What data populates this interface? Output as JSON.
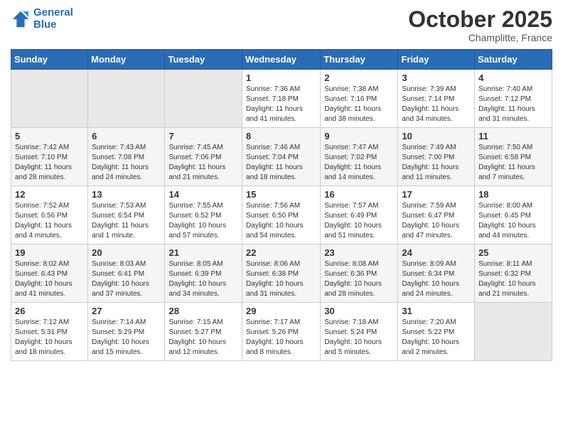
{
  "header": {
    "logo_line1": "General",
    "logo_line2": "Blue",
    "month": "October 2025",
    "location": "Champlitte, France"
  },
  "weekdays": [
    "Sunday",
    "Monday",
    "Tuesday",
    "Wednesday",
    "Thursday",
    "Friday",
    "Saturday"
  ],
  "weeks": [
    [
      {
        "day": "",
        "sunrise": "",
        "sunset": "",
        "daylight": ""
      },
      {
        "day": "",
        "sunrise": "",
        "sunset": "",
        "daylight": ""
      },
      {
        "day": "",
        "sunrise": "",
        "sunset": "",
        "daylight": ""
      },
      {
        "day": "1",
        "sunrise": "Sunrise: 7:36 AM",
        "sunset": "Sunset: 7:18 PM",
        "daylight": "Daylight: 11 hours and 41 minutes."
      },
      {
        "day": "2",
        "sunrise": "Sunrise: 7:38 AM",
        "sunset": "Sunset: 7:16 PM",
        "daylight": "Daylight: 11 hours and 38 minutes."
      },
      {
        "day": "3",
        "sunrise": "Sunrise: 7:39 AM",
        "sunset": "Sunset: 7:14 PM",
        "daylight": "Daylight: 11 hours and 34 minutes."
      },
      {
        "day": "4",
        "sunrise": "Sunrise: 7:40 AM",
        "sunset": "Sunset: 7:12 PM",
        "daylight": "Daylight: 11 hours and 31 minutes."
      }
    ],
    [
      {
        "day": "5",
        "sunrise": "Sunrise: 7:42 AM",
        "sunset": "Sunset: 7:10 PM",
        "daylight": "Daylight: 11 hours and 28 minutes."
      },
      {
        "day": "6",
        "sunrise": "Sunrise: 7:43 AM",
        "sunset": "Sunset: 7:08 PM",
        "daylight": "Daylight: 11 hours and 24 minutes."
      },
      {
        "day": "7",
        "sunrise": "Sunrise: 7:45 AM",
        "sunset": "Sunset: 7:06 PM",
        "daylight": "Daylight: 11 hours and 21 minutes."
      },
      {
        "day": "8",
        "sunrise": "Sunrise: 7:46 AM",
        "sunset": "Sunset: 7:04 PM",
        "daylight": "Daylight: 11 hours and 18 minutes."
      },
      {
        "day": "9",
        "sunrise": "Sunrise: 7:47 AM",
        "sunset": "Sunset: 7:02 PM",
        "daylight": "Daylight: 11 hours and 14 minutes."
      },
      {
        "day": "10",
        "sunrise": "Sunrise: 7:49 AM",
        "sunset": "Sunset: 7:00 PM",
        "daylight": "Daylight: 11 hours and 11 minutes."
      },
      {
        "day": "11",
        "sunrise": "Sunrise: 7:50 AM",
        "sunset": "Sunset: 6:58 PM",
        "daylight": "Daylight: 11 hours and 7 minutes."
      }
    ],
    [
      {
        "day": "12",
        "sunrise": "Sunrise: 7:52 AM",
        "sunset": "Sunset: 6:56 PM",
        "daylight": "Daylight: 11 hours and 4 minutes."
      },
      {
        "day": "13",
        "sunrise": "Sunrise: 7:53 AM",
        "sunset": "Sunset: 6:54 PM",
        "daylight": "Daylight: 11 hours and 1 minute."
      },
      {
        "day": "14",
        "sunrise": "Sunrise: 7:55 AM",
        "sunset": "Sunset: 6:52 PM",
        "daylight": "Daylight: 10 hours and 57 minutes."
      },
      {
        "day": "15",
        "sunrise": "Sunrise: 7:56 AM",
        "sunset": "Sunset: 6:50 PM",
        "daylight": "Daylight: 10 hours and 54 minutes."
      },
      {
        "day": "16",
        "sunrise": "Sunrise: 7:57 AM",
        "sunset": "Sunset: 6:49 PM",
        "daylight": "Daylight: 10 hours and 51 minutes."
      },
      {
        "day": "17",
        "sunrise": "Sunrise: 7:59 AM",
        "sunset": "Sunset: 6:47 PM",
        "daylight": "Daylight: 10 hours and 47 minutes."
      },
      {
        "day": "18",
        "sunrise": "Sunrise: 8:00 AM",
        "sunset": "Sunset: 6:45 PM",
        "daylight": "Daylight: 10 hours and 44 minutes."
      }
    ],
    [
      {
        "day": "19",
        "sunrise": "Sunrise: 8:02 AM",
        "sunset": "Sunset: 6:43 PM",
        "daylight": "Daylight: 10 hours and 41 minutes."
      },
      {
        "day": "20",
        "sunrise": "Sunrise: 8:03 AM",
        "sunset": "Sunset: 6:41 PM",
        "daylight": "Daylight: 10 hours and 37 minutes."
      },
      {
        "day": "21",
        "sunrise": "Sunrise: 8:05 AM",
        "sunset": "Sunset: 6:39 PM",
        "daylight": "Daylight: 10 hours and 34 minutes."
      },
      {
        "day": "22",
        "sunrise": "Sunrise: 8:06 AM",
        "sunset": "Sunset: 6:38 PM",
        "daylight": "Daylight: 10 hours and 31 minutes."
      },
      {
        "day": "23",
        "sunrise": "Sunrise: 8:08 AM",
        "sunset": "Sunset: 6:36 PM",
        "daylight": "Daylight: 10 hours and 28 minutes."
      },
      {
        "day": "24",
        "sunrise": "Sunrise: 8:09 AM",
        "sunset": "Sunset: 6:34 PM",
        "daylight": "Daylight: 10 hours and 24 minutes."
      },
      {
        "day": "25",
        "sunrise": "Sunrise: 8:11 AM",
        "sunset": "Sunset: 6:32 PM",
        "daylight": "Daylight: 10 hours and 21 minutes."
      }
    ],
    [
      {
        "day": "26",
        "sunrise": "Sunrise: 7:12 AM",
        "sunset": "Sunset: 5:31 PM",
        "daylight": "Daylight: 10 hours and 18 minutes."
      },
      {
        "day": "27",
        "sunrise": "Sunrise: 7:14 AM",
        "sunset": "Sunset: 5:29 PM",
        "daylight": "Daylight: 10 hours and 15 minutes."
      },
      {
        "day": "28",
        "sunrise": "Sunrise: 7:15 AM",
        "sunset": "Sunset: 5:27 PM",
        "daylight": "Daylight: 10 hours and 12 minutes."
      },
      {
        "day": "29",
        "sunrise": "Sunrise: 7:17 AM",
        "sunset": "Sunset: 5:26 PM",
        "daylight": "Daylight: 10 hours and 8 minutes."
      },
      {
        "day": "30",
        "sunrise": "Sunrise: 7:18 AM",
        "sunset": "Sunset: 5:24 PM",
        "daylight": "Daylight: 10 hours and 5 minutes."
      },
      {
        "day": "31",
        "sunrise": "Sunrise: 7:20 AM",
        "sunset": "Sunset: 5:22 PM",
        "daylight": "Daylight: 10 hours and 2 minutes."
      },
      {
        "day": "",
        "sunrise": "",
        "sunset": "",
        "daylight": ""
      }
    ]
  ]
}
